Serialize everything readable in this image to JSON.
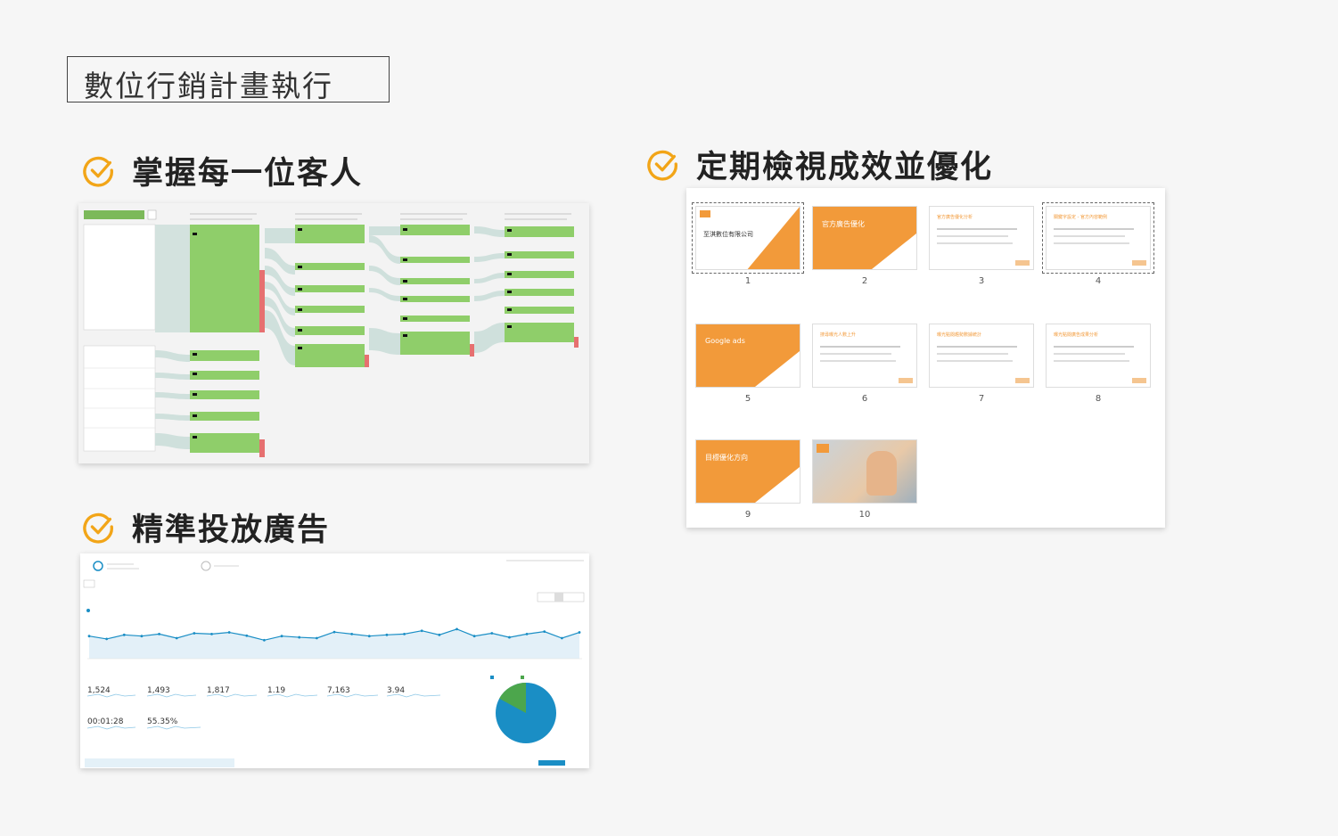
{
  "page_title": "數位行銷計畫執行",
  "sections": {
    "customers": "掌握每一位客人",
    "ads": "精準投放廣告",
    "review": "定期檢視成效並優化"
  },
  "colors": {
    "accent": "#f2a518",
    "flow_green": "#8fce6a",
    "slide_orange": "#f29a3a",
    "chart_blue": "#1a8ec5",
    "pie_green": "#4ca64c"
  },
  "flow": {
    "columns": [
      "",
      "",
      "",
      "",
      ""
    ]
  },
  "analytics": {
    "metrics": [
      {
        "value": "1,524"
      },
      {
        "value": "1,493"
      },
      {
        "value": "1,817"
      },
      {
        "value": "1.19"
      },
      {
        "value": "7,163"
      },
      {
        "value": "3.94"
      },
      {
        "value": "00:01:28"
      },
      {
        "value": "55.35%"
      }
    ],
    "line_values": [
      0.55,
      0.48,
      0.58,
      0.55,
      0.6,
      0.5,
      0.62,
      0.6,
      0.64,
      0.56,
      0.45,
      0.55,
      0.52,
      0.5,
      0.65,
      0.6,
      0.55,
      0.58,
      0.6,
      0.68,
      0.58,
      0.72,
      0.55,
      0.62,
      0.52,
      0.6,
      0.66,
      0.5,
      0.64
    ],
    "pie": {
      "values": [
        82.9,
        17.1
      ]
    }
  },
  "slides": [
    {
      "num": "1",
      "title": "至淇數位有限公司",
      "style": "title"
    },
    {
      "num": "2",
      "title": "官方廣告優化",
      "style": "orange"
    },
    {
      "num": "3",
      "title": "官方廣告優化分析",
      "style": "white"
    },
    {
      "num": "4",
      "title": "關鍵字設定 - 官方內容範例",
      "style": "white"
    },
    {
      "num": "5",
      "title": "Google ads",
      "style": "orange"
    },
    {
      "num": "6",
      "title": "搜尋曝光人數上升",
      "style": "white"
    },
    {
      "num": "7",
      "title": "曝光點閱趨勢數據統計",
      "style": "white"
    },
    {
      "num": "8",
      "title": "曝光點閱廣告成果分析",
      "style": "white"
    },
    {
      "num": "9",
      "title": "目標優化方向",
      "style": "orange"
    },
    {
      "num": "10",
      "title": "",
      "style": "photo"
    }
  ]
}
